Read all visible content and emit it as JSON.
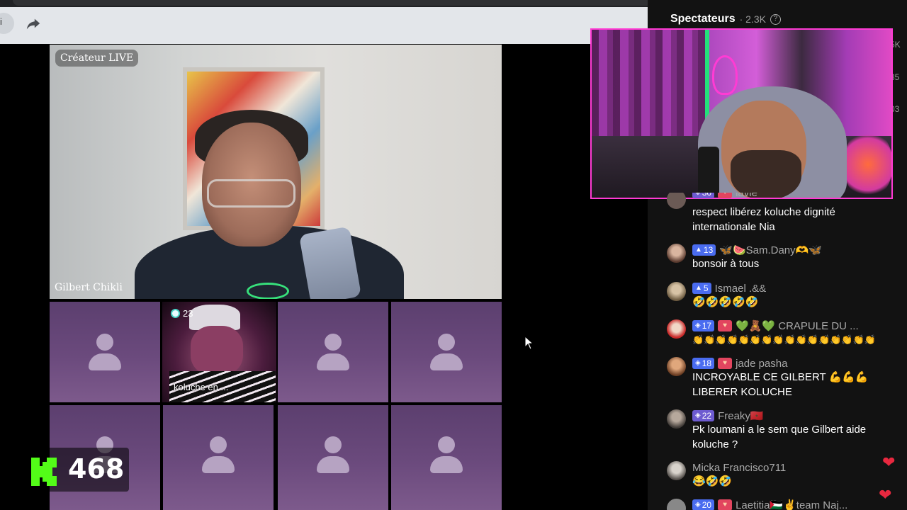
{
  "toolbar": {
    "back_glyph": "i",
    "share_icon": "share-arrow-icon"
  },
  "main_video": {
    "badge": "Créateur LIVE",
    "host_name": "Gilbert Chikli"
  },
  "guest": {
    "gem_count": "23",
    "name": "koluche en ..."
  },
  "kick": {
    "viewer_count": "468",
    "brand_color": "#53fc18"
  },
  "right_panel": {
    "title": "Spectateurs",
    "count": "· 2.3K",
    "help_icon": "question-circle-icon",
    "side_numbers": [
      "5K",
      "35",
      "03"
    ]
  },
  "chat": [
    {
      "level": "30",
      "name": "lavie",
      "emoji": "",
      "text": "respect libérez koluche dignité internationale Nia",
      "heart": true
    },
    {
      "level": "13",
      "name": "🦋🍉Sam.Dany🫶🦋",
      "emoji": "",
      "text": "bonsoir à tous",
      "heart": false
    },
    {
      "level": "5",
      "name": "Ismael .&&",
      "emoji": "",
      "text": "🤣🤣🤣🤣🤣",
      "heart": false
    },
    {
      "level": "17",
      "name": "💚🧸💚 CRAPULE DU ...",
      "emoji": "",
      "text": "👏👏👏👏👏👏👏👏👏👏👏👏👏👏👏👏",
      "heart": true
    },
    {
      "level": "18",
      "name": "jade pasha",
      "emoji": "",
      "text": "INCROYABLE CE GILBERT 💪💪💪 LIBERER KOLUCHE",
      "heart": true
    },
    {
      "level": "22",
      "name": "Freaky🇲🇦",
      "emoji": "",
      "text": "Pk loumani a le sem que Gilbert aide koluche ?",
      "heart": false
    },
    {
      "level": "",
      "name": "Micka Francisco711",
      "emoji": "",
      "text": "😂🤣🤣",
      "heart": false
    },
    {
      "level": "20",
      "name": "Laetitia🇵🇸✌️team Naj...",
      "emoji": "",
      "text": "",
      "heart": true
    }
  ],
  "colors": {
    "panel_bg": "#121212",
    "level_badge": "#4a6cf0",
    "reaction_heart": "#e8283f",
    "slot_purple": "#6b4a7d"
  }
}
